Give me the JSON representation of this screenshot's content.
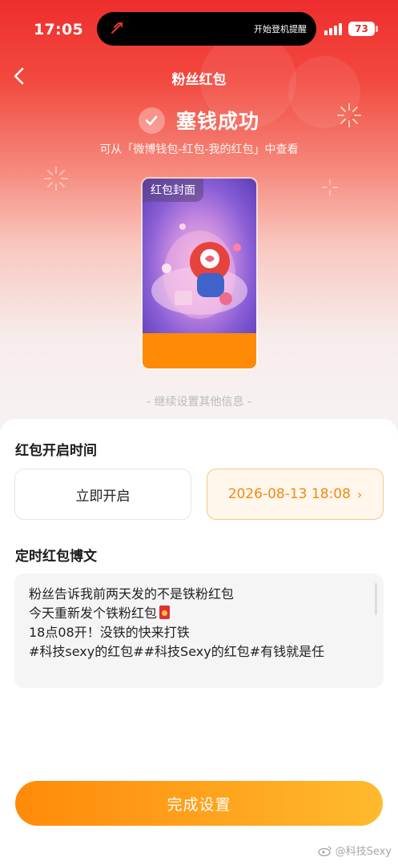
{
  "status_bar": {
    "time": "17:05",
    "island_text": "开始登机提醒",
    "battery": "73"
  },
  "nav": {
    "title": "粉丝红包"
  },
  "success": {
    "title": "塞钱成功",
    "subtitle": "可从「微博钱包-红包-我的红包」中查看"
  },
  "cover": {
    "tag": "红包封面"
  },
  "continue_hint": "- 继续设置其他信息 -",
  "open_time": {
    "section_title": "红包开启时间",
    "option_now": "立即开启",
    "option_scheduled": "2026-08-13 18:08"
  },
  "post": {
    "section_title": "定时红包博文",
    "lines": [
      "粉丝告诉我前两天发的不是铁粉红包",
      "今天重新发个铁粉红包",
      "18点08开！没铁的快来打铁",
      "#科技sexy的红包##科技Sexy的红包#有钱就是任"
    ]
  },
  "done_button": "完成设置",
  "watermark": "@科技Sexy",
  "colors": {
    "brand_red": "#ee2e2e",
    "accent_orange": "#ff8a06",
    "scheduled_text": "#f28a12"
  }
}
